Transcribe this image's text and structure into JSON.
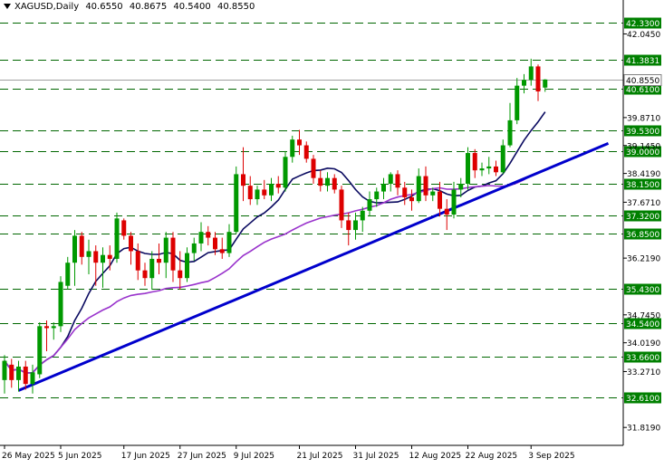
{
  "header": {
    "symbol": "XAGUSD,Daily",
    "open": "40.6550",
    "high": "40.8675",
    "low": "40.5400",
    "close": "40.8550"
  },
  "colors": {
    "bull": "#009900",
    "bear": "#dd0000",
    "level_line": "#006600",
    "level_label_bg": "#008000",
    "price_label_bg": "#ffffff",
    "trendline": "#0000cc",
    "ma_fast": "#0a0a60",
    "ma_slow": "#9933cc",
    "grid": "#c0c0c0",
    "axis": "#000000"
  },
  "chart_data": {
    "type": "candlestick",
    "title": "XAGUSD,Daily",
    "ylim": [
      31.4,
      42.55
    ],
    "x_tick_labels": [
      {
        "index": 0,
        "label": "26 May 2025"
      },
      {
        "index": 8,
        "label": "5 Jun 2025"
      },
      {
        "index": 17,
        "label": "17 Jun 2025"
      },
      {
        "index": 25,
        "label": "27 Jun 2025"
      },
      {
        "index": 33,
        "label": "9 Jul 2025"
      },
      {
        "index": 42,
        "label": "21 Jul 2025"
      },
      {
        "index": 50,
        "label": "31 Jul 2025"
      },
      {
        "index": 58,
        "label": "12 Aug 2025"
      },
      {
        "index": 66,
        "label": "22 Aug 2025"
      },
      {
        "index": 75,
        "label": "3 Sep 2025"
      }
    ],
    "y_tick_labels": [
      "42.0450",
      "39.8710",
      "39.1450",
      "38.4190",
      "37.6710",
      "36.2190",
      "34.7450",
      "34.0190",
      "33.2710",
      "31.8190"
    ],
    "horizontal_levels": [
      "42.3300",
      "41.3831",
      "40.6100",
      "39.5300",
      "39.0000",
      "38.1500",
      "37.3200",
      "36.8500",
      "35.4300",
      "34.5400",
      "33.6600",
      "32.6100"
    ],
    "current_price": "40.8550",
    "ohlc": [
      {
        "o": 33.05,
        "h": 33.7,
        "l": 32.7,
        "c": 33.55
      },
      {
        "o": 33.45,
        "h": 33.6,
        "l": 32.85,
        "c": 33.05
      },
      {
        "o": 33.05,
        "h": 33.55,
        "l": 32.75,
        "c": 33.4
      },
      {
        "o": 33.4,
        "h": 33.55,
        "l": 32.8,
        "c": 32.95
      },
      {
        "o": 32.95,
        "h": 33.45,
        "l": 32.7,
        "c": 33.25
      },
      {
        "o": 33.2,
        "h": 34.55,
        "l": 33.1,
        "c": 34.45
      },
      {
        "o": 34.45,
        "h": 34.6,
        "l": 33.8,
        "c": 34.4
      },
      {
        "o": 34.4,
        "h": 34.55,
        "l": 34.1,
        "c": 34.45
      },
      {
        "o": 34.45,
        "h": 35.75,
        "l": 34.3,
        "c": 35.6
      },
      {
        "o": 35.5,
        "h": 36.25,
        "l": 35.4,
        "c": 36.1
      },
      {
        "o": 36.1,
        "h": 36.95,
        "l": 35.5,
        "c": 36.8
      },
      {
        "o": 36.8,
        "h": 36.9,
        "l": 36.05,
        "c": 36.25
      },
      {
        "o": 36.25,
        "h": 36.7,
        "l": 35.8,
        "c": 36.4
      },
      {
        "o": 36.4,
        "h": 36.55,
        "l": 35.5,
        "c": 36.1
      },
      {
        "o": 36.1,
        "h": 36.5,
        "l": 35.45,
        "c": 36.3
      },
      {
        "o": 36.3,
        "h": 36.55,
        "l": 35.9,
        "c": 36.2
      },
      {
        "o": 36.2,
        "h": 37.4,
        "l": 36.1,
        "c": 37.25
      },
      {
        "o": 37.2,
        "h": 37.25,
        "l": 36.7,
        "c": 36.8
      },
      {
        "o": 36.8,
        "h": 36.9,
        "l": 36.05,
        "c": 36.4
      },
      {
        "o": 36.4,
        "h": 36.6,
        "l": 35.65,
        "c": 35.9
      },
      {
        "o": 35.9,
        "h": 36.1,
        "l": 35.5,
        "c": 35.7
      },
      {
        "o": 35.7,
        "h": 36.4,
        "l": 35.4,
        "c": 36.2
      },
      {
        "o": 36.2,
        "h": 36.6,
        "l": 35.8,
        "c": 36.1
      },
      {
        "o": 36.1,
        "h": 36.9,
        "l": 35.7,
        "c": 36.75
      },
      {
        "o": 36.75,
        "h": 36.9,
        "l": 35.6,
        "c": 35.9
      },
      {
        "o": 35.9,
        "h": 36.4,
        "l": 35.4,
        "c": 35.7
      },
      {
        "o": 35.7,
        "h": 36.5,
        "l": 35.6,
        "c": 36.35
      },
      {
        "o": 36.35,
        "h": 36.75,
        "l": 36.15,
        "c": 36.6
      },
      {
        "o": 36.6,
        "h": 37.15,
        "l": 36.4,
        "c": 36.9
      },
      {
        "o": 36.9,
        "h": 37.05,
        "l": 36.55,
        "c": 36.75
      },
      {
        "o": 36.75,
        "h": 36.9,
        "l": 36.3,
        "c": 36.45
      },
      {
        "o": 36.45,
        "h": 36.75,
        "l": 36.2,
        "c": 36.35
      },
      {
        "o": 36.35,
        "h": 37.1,
        "l": 36.25,
        "c": 36.9
      },
      {
        "o": 36.9,
        "h": 38.6,
        "l": 36.85,
        "c": 38.4
      },
      {
        "o": 38.4,
        "h": 39.1,
        "l": 37.7,
        "c": 38.1
      },
      {
        "o": 38.1,
        "h": 38.35,
        "l": 37.6,
        "c": 37.75
      },
      {
        "o": 37.75,
        "h": 38.1,
        "l": 37.6,
        "c": 38.0
      },
      {
        "o": 38.0,
        "h": 38.25,
        "l": 37.75,
        "c": 37.85
      },
      {
        "o": 37.85,
        "h": 38.3,
        "l": 37.7,
        "c": 38.15
      },
      {
        "o": 38.15,
        "h": 38.35,
        "l": 37.9,
        "c": 38.05
      },
      {
        "o": 38.05,
        "h": 39.0,
        "l": 37.95,
        "c": 38.85
      },
      {
        "o": 38.85,
        "h": 39.4,
        "l": 38.7,
        "c": 39.3
      },
      {
        "o": 39.3,
        "h": 39.55,
        "l": 38.9,
        "c": 39.15
      },
      {
        "o": 39.15,
        "h": 39.25,
        "l": 38.7,
        "c": 38.8
      },
      {
        "o": 38.8,
        "h": 38.9,
        "l": 38.15,
        "c": 38.3
      },
      {
        "o": 38.3,
        "h": 38.5,
        "l": 37.95,
        "c": 38.1
      },
      {
        "o": 38.1,
        "h": 38.45,
        "l": 37.95,
        "c": 38.3
      },
      {
        "o": 38.3,
        "h": 38.4,
        "l": 37.9,
        "c": 38.0
      },
      {
        "o": 38.0,
        "h": 38.1,
        "l": 37.0,
        "c": 37.2
      },
      {
        "o": 37.2,
        "h": 37.4,
        "l": 36.55,
        "c": 36.95
      },
      {
        "o": 36.95,
        "h": 37.4,
        "l": 36.7,
        "c": 37.2
      },
      {
        "o": 37.2,
        "h": 37.55,
        "l": 36.9,
        "c": 37.45
      },
      {
        "o": 37.45,
        "h": 37.95,
        "l": 37.3,
        "c": 37.75
      },
      {
        "o": 37.75,
        "h": 38.05,
        "l": 37.55,
        "c": 37.95
      },
      {
        "o": 37.95,
        "h": 38.3,
        "l": 37.75,
        "c": 38.15
      },
      {
        "o": 38.15,
        "h": 38.45,
        "l": 37.95,
        "c": 38.4
      },
      {
        "o": 38.4,
        "h": 38.5,
        "l": 37.85,
        "c": 38.05
      },
      {
        "o": 38.05,
        "h": 38.2,
        "l": 37.6,
        "c": 37.8
      },
      {
        "o": 37.8,
        "h": 38.0,
        "l": 37.45,
        "c": 37.7
      },
      {
        "o": 37.7,
        "h": 38.55,
        "l": 37.65,
        "c": 38.35
      },
      {
        "o": 38.35,
        "h": 38.6,
        "l": 37.7,
        "c": 37.85
      },
      {
        "o": 37.85,
        "h": 38.05,
        "l": 37.7,
        "c": 37.95
      },
      {
        "o": 37.95,
        "h": 38.2,
        "l": 37.3,
        "c": 37.5
      },
      {
        "o": 37.5,
        "h": 37.75,
        "l": 36.95,
        "c": 37.35
      },
      {
        "o": 37.35,
        "h": 38.2,
        "l": 37.25,
        "c": 38.0
      },
      {
        "o": 38.0,
        "h": 38.3,
        "l": 37.8,
        "c": 38.15
      },
      {
        "o": 38.15,
        "h": 39.1,
        "l": 38.0,
        "c": 38.95
      },
      {
        "o": 38.95,
        "h": 39.05,
        "l": 38.3,
        "c": 38.5
      },
      {
        "o": 38.5,
        "h": 38.7,
        "l": 38.35,
        "c": 38.55
      },
      {
        "o": 38.55,
        "h": 38.85,
        "l": 38.4,
        "c": 38.6
      },
      {
        "o": 38.6,
        "h": 38.75,
        "l": 38.35,
        "c": 38.45
      },
      {
        "o": 38.45,
        "h": 39.3,
        "l": 38.4,
        "c": 39.15
      },
      {
        "o": 39.15,
        "h": 40.25,
        "l": 39.1,
        "c": 39.8
      },
      {
        "o": 39.8,
        "h": 40.9,
        "l": 39.7,
        "c": 40.7
      },
      {
        "o": 40.7,
        "h": 41.0,
        "l": 40.5,
        "c": 40.85
      },
      {
        "o": 40.85,
        "h": 41.4,
        "l": 40.7,
        "c": 41.2
      },
      {
        "o": 41.2,
        "h": 41.25,
        "l": 40.3,
        "c": 40.55
      },
      {
        "o": 40.65,
        "h": 40.87,
        "l": 40.54,
        "c": 40.86
      }
    ],
    "trendline": {
      "from": {
        "index": 2,
        "price": 32.78
      },
      "to": {
        "index": 86,
        "price": 39.2
      }
    },
    "moving_averages": [
      {
        "name": "",
        "color_key": "ma_fast",
        "period": 9
      },
      {
        "name": "",
        "color_key": "ma_slow",
        "period": 30
      }
    ]
  }
}
